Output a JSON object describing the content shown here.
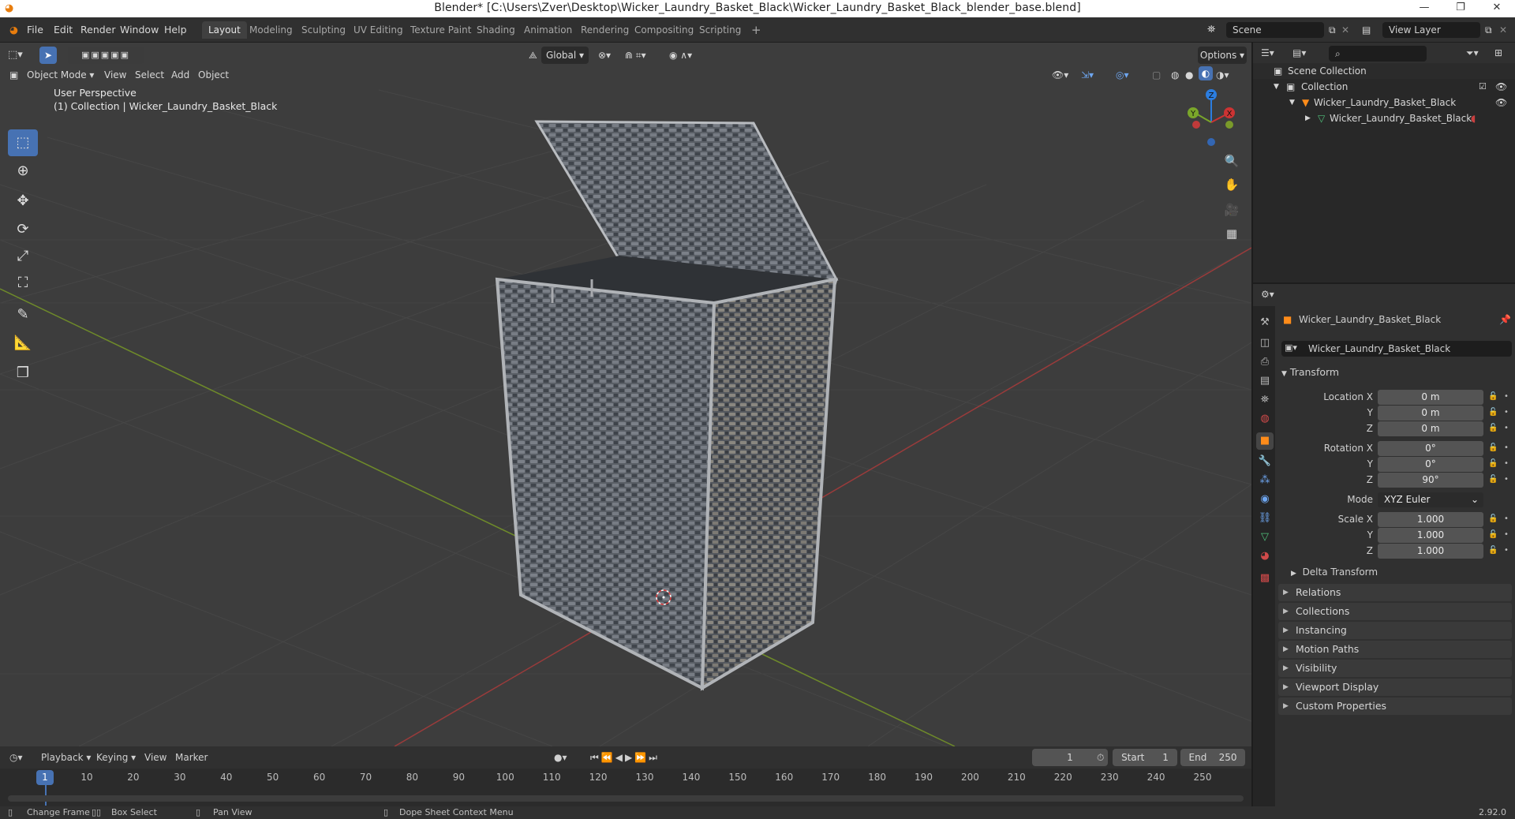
{
  "window": {
    "title": "Blender* [C:\\Users\\Zver\\Desktop\\Wicker_Laundry_Basket_Black\\Wicker_Laundry_Basket_Black_blender_base.blend]"
  },
  "menu": [
    "File",
    "Edit",
    "Render",
    "Window",
    "Help"
  ],
  "workspaces": [
    "Layout",
    "Modeling",
    "Sculpting",
    "UV Editing",
    "Texture Paint",
    "Shading",
    "Animation",
    "Rendering",
    "Compositing",
    "Scripting"
  ],
  "active_workspace": "Layout",
  "scene": {
    "label": "Scene",
    "view_layer": "View Layer"
  },
  "viewport": {
    "mode": "Object Mode",
    "menus": [
      "View",
      "Select",
      "Add",
      "Object"
    ],
    "orientation": "Global",
    "options_label": "Options",
    "perspective": "User Perspective",
    "collection_info": "(1) Collection | Wicker_Laundry_Basket_Black",
    "gizmo_axes": [
      "Z",
      "Y",
      "X"
    ]
  },
  "timeline": {
    "menus": [
      "Playback",
      "Keying",
      "View",
      "Marker"
    ],
    "current_frame": "1",
    "start_label": "Start",
    "start_value": "1",
    "end_label": "End",
    "end_value": "250",
    "ruler": [
      "1",
      "10",
      "20",
      "30",
      "40",
      "50",
      "60",
      "70",
      "80",
      "90",
      "100",
      "110",
      "120",
      "130",
      "140",
      "150",
      "160",
      "170",
      "180",
      "190",
      "200",
      "210",
      "220",
      "230",
      "240",
      "250"
    ]
  },
  "status": {
    "change_frame": "Change Frame",
    "box_select": "Box Select",
    "pan_view": "Pan View",
    "context_menu": "Dope Sheet Context Menu",
    "version": "2.92.0"
  },
  "outliner": {
    "scene_collection": "Scene Collection",
    "collection": "Collection",
    "object": "Wicker_Laundry_Basket_Black",
    "mesh": "Wicker_Laundry_Basket_Black"
  },
  "properties": {
    "object_name": "Wicker_Laundry_Basket_Black",
    "object_field": "Wicker_Laundry_Basket_Black",
    "transform_label": "Transform",
    "location": {
      "label": "Location X",
      "x": "0 m",
      "y": "0 m",
      "z": "0 m"
    },
    "rotation": {
      "label": "Rotation X",
      "x": "0°",
      "y": "0°",
      "z": "90°"
    },
    "mode_label": "Mode",
    "mode_value": "XYZ Euler",
    "scale": {
      "label": "Scale X",
      "x": "1.000",
      "y": "1.000",
      "z": "1.000"
    },
    "axis_y": "Y",
    "axis_z": "Z",
    "delta_transform": "Delta Transform",
    "panels": [
      "Relations",
      "Collections",
      "Instancing",
      "Motion Paths",
      "Visibility",
      "Viewport Display",
      "Custom Properties"
    ]
  },
  "colors": {
    "accent": "#4772b3",
    "object_orange": "#ff8c1a",
    "x_axis": "#cc3333",
    "y_axis": "#7aa62a",
    "z_axis": "#2b7de0"
  }
}
